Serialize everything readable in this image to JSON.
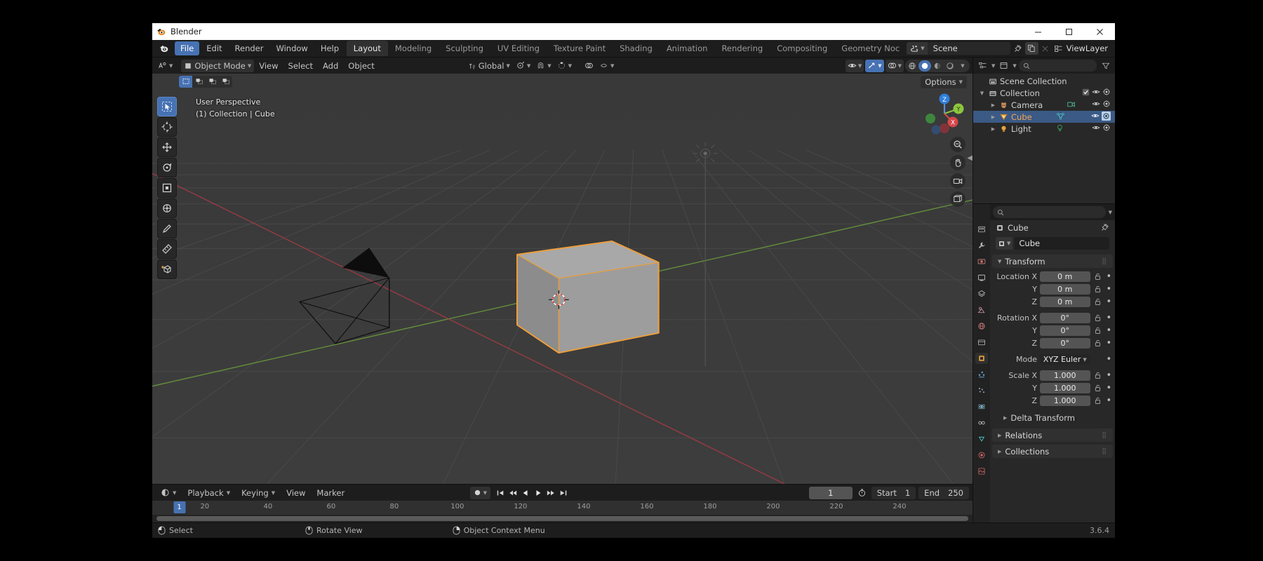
{
  "window": {
    "title": "Blender",
    "controls": {
      "minimize": "—",
      "maximize": "❐",
      "close": "✕"
    }
  },
  "topbar": {
    "menus": [
      "File",
      "Edit",
      "Render",
      "Window",
      "Help"
    ],
    "active_menu": "File",
    "workspaces": [
      "Layout",
      "Modeling",
      "Sculpting",
      "UV Editing",
      "Texture Paint",
      "Shading",
      "Animation",
      "Rendering",
      "Compositing",
      "Geometry Noc"
    ],
    "active_workspace": "Layout",
    "scene_name": "Scene",
    "viewlayer_name": "ViewLayer"
  },
  "viewport_header": {
    "mode": "Object Mode",
    "menus": [
      "View",
      "Select",
      "Add",
      "Object"
    ],
    "transform_orientation": "Global",
    "options_label": "Options",
    "shading_modes": [
      "wireframe",
      "solid",
      "material",
      "rendered"
    ],
    "active_shading": "solid"
  },
  "viewport": {
    "overlay_line1": "User Perspective",
    "overlay_line2": "(1) Collection | Cube",
    "gizmo_axes": [
      "Z",
      "Y",
      "X"
    ],
    "tools": [
      "select-box",
      "cursor",
      "move",
      "rotate",
      "scale",
      "transform",
      "annotate",
      "measure",
      "add-cube"
    ]
  },
  "timeline": {
    "menus": [
      "Playback",
      "Keying",
      "View",
      "Marker"
    ],
    "current_frame": "1",
    "start_label": "Start",
    "start_value": "1",
    "end_label": "End",
    "end_value": "250",
    "ruler_ticks": [
      "20",
      "40",
      "60",
      "80",
      "100",
      "120",
      "140",
      "160",
      "180",
      "200",
      "220",
      "240"
    ],
    "playhead_label": "1"
  },
  "outliner": {
    "rows": [
      {
        "name": "Scene Collection",
        "icon": "scene-collection-icon",
        "depth": 0,
        "selected": false,
        "has_triangle": false,
        "checkbox": false,
        "eye": false,
        "camera": false
      },
      {
        "name": "Collection",
        "icon": "collection-icon",
        "depth": 1,
        "selected": false,
        "has_triangle": true,
        "checkbox": true,
        "eye": true,
        "camera": true
      },
      {
        "name": "Camera",
        "icon": "camera-object-icon",
        "depth": 2,
        "selected": false,
        "has_triangle": true,
        "checkbox": false,
        "eye": true,
        "camera": true,
        "data_icon": "camera-data-icon"
      },
      {
        "name": "Cube",
        "icon": "mesh-object-icon",
        "depth": 2,
        "selected": true,
        "has_triangle": true,
        "checkbox": false,
        "eye": true,
        "camera": true,
        "data_icon": "mesh-data-icon"
      },
      {
        "name": "Light",
        "icon": "light-object-icon",
        "depth": 2,
        "selected": false,
        "has_triangle": true,
        "checkbox": false,
        "eye": true,
        "camera": true,
        "data_icon": "light-data-icon"
      }
    ]
  },
  "properties": {
    "breadcrumb": "Cube",
    "object_name": "Cube",
    "transform": {
      "title": "Transform",
      "rows": [
        {
          "label": "Location X",
          "value": "0 m"
        },
        {
          "label": "Y",
          "value": "0 m"
        },
        {
          "label": "Z",
          "value": "0 m"
        },
        {
          "label": "Rotation X",
          "value": "0°"
        },
        {
          "label": "Y",
          "value": "0°"
        },
        {
          "label": "Z",
          "value": "0°"
        }
      ],
      "mode_label": "Mode",
      "mode_value": "XYZ Euler",
      "scale_rows": [
        {
          "label": "Scale X",
          "value": "1.000"
        },
        {
          "label": "Y",
          "value": "1.000"
        },
        {
          "label": "Z",
          "value": "1.000"
        }
      ],
      "delta_transform": "Delta Transform"
    },
    "panels": [
      "Relations",
      "Collections"
    ]
  },
  "statusbar": {
    "items": [
      {
        "icon": "mouse-left-icon",
        "label": "Select"
      },
      {
        "icon": "mouse-middle-icon",
        "label": "Rotate View"
      },
      {
        "icon": "mouse-right-icon",
        "label": "Object Context Menu"
      }
    ],
    "version": "3.6.4"
  },
  "colors": {
    "accent": "#4772b3",
    "selected_text": "#f0a55a",
    "outline": "#ed9e3b",
    "background": "#3b3b3b"
  }
}
